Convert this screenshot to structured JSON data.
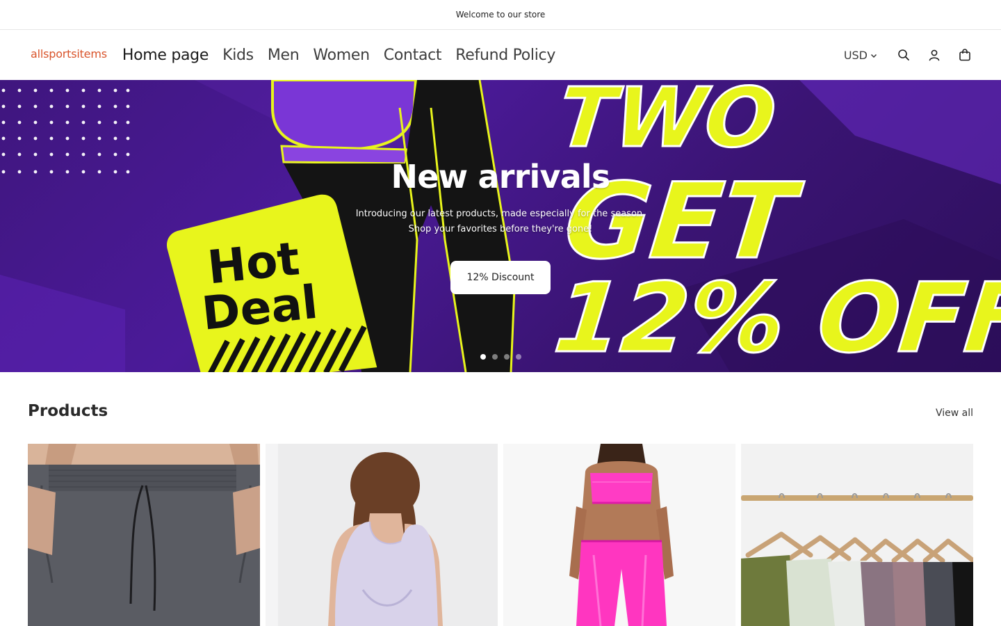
{
  "announcement": "Welcome to our store",
  "header": {
    "logo": "allsportsitems",
    "nav": [
      "Home page",
      "Kids",
      "Men",
      "Women",
      "Contact",
      "Refund Policy"
    ],
    "currency": "USD",
    "icons": [
      "search-icon",
      "account-icon",
      "cart-icon"
    ]
  },
  "hero": {
    "title": "New arrivals",
    "subtitle_line1": "Introducing our latest products, made especially for the season.",
    "subtitle_line2": "Shop your favorites before they're gone!",
    "button": "12% Discount",
    "badge_line1": "Hot",
    "badge_line2": "Deal",
    "promo_line1": "TWO",
    "promo_line2": "GET",
    "promo_line3": "12% OFF",
    "slide_count": 4,
    "active_slide": 1
  },
  "products": {
    "title": "Products",
    "view_all": "View all",
    "items": [
      {
        "image": "grey athletic shorts"
      },
      {
        "image": "lavender tank top back view"
      },
      {
        "image": "pink metallic sports set"
      },
      {
        "image": "sports bras on hangers"
      }
    ]
  },
  "colors": {
    "logo": "#d9542b",
    "hero_purple": "#4b1a99",
    "promo_yellow": "#e8f51c"
  }
}
